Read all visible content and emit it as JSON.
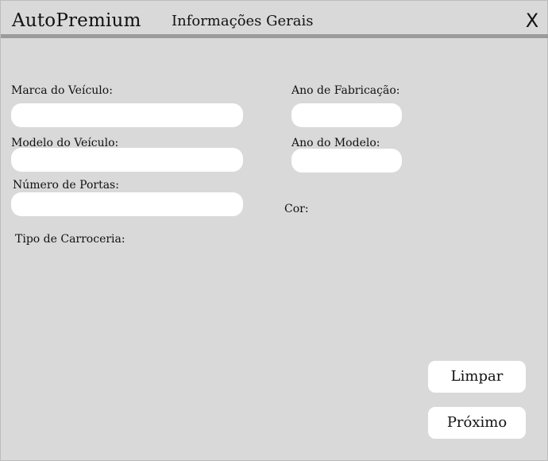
{
  "header": {
    "app_title": "AutoPremium",
    "section_title": "Informações Gerais",
    "close_label": "X"
  },
  "form": {
    "marca_label": "Marca do Veículo:",
    "modelo_label": "Modelo do Veículo:",
    "portas_label": "Número de Portas:",
    "carroceria_label": "Tipo de Carroceria:",
    "ano_fabricacao_label": "Ano de Fabricação:",
    "ano_modelo_label": "Ano do Modelo:",
    "cor_label": "Cor:",
    "marca_value": "",
    "modelo_value": "",
    "portas_value": "",
    "ano_fabricacao_value": "",
    "ano_modelo_value": ""
  },
  "actions": {
    "clear_label": "Limpar",
    "next_label": "Próximo"
  },
  "colors": {
    "background": "#d9d9d9",
    "divider": "#9b9b9b",
    "field": "#ffffff"
  }
}
